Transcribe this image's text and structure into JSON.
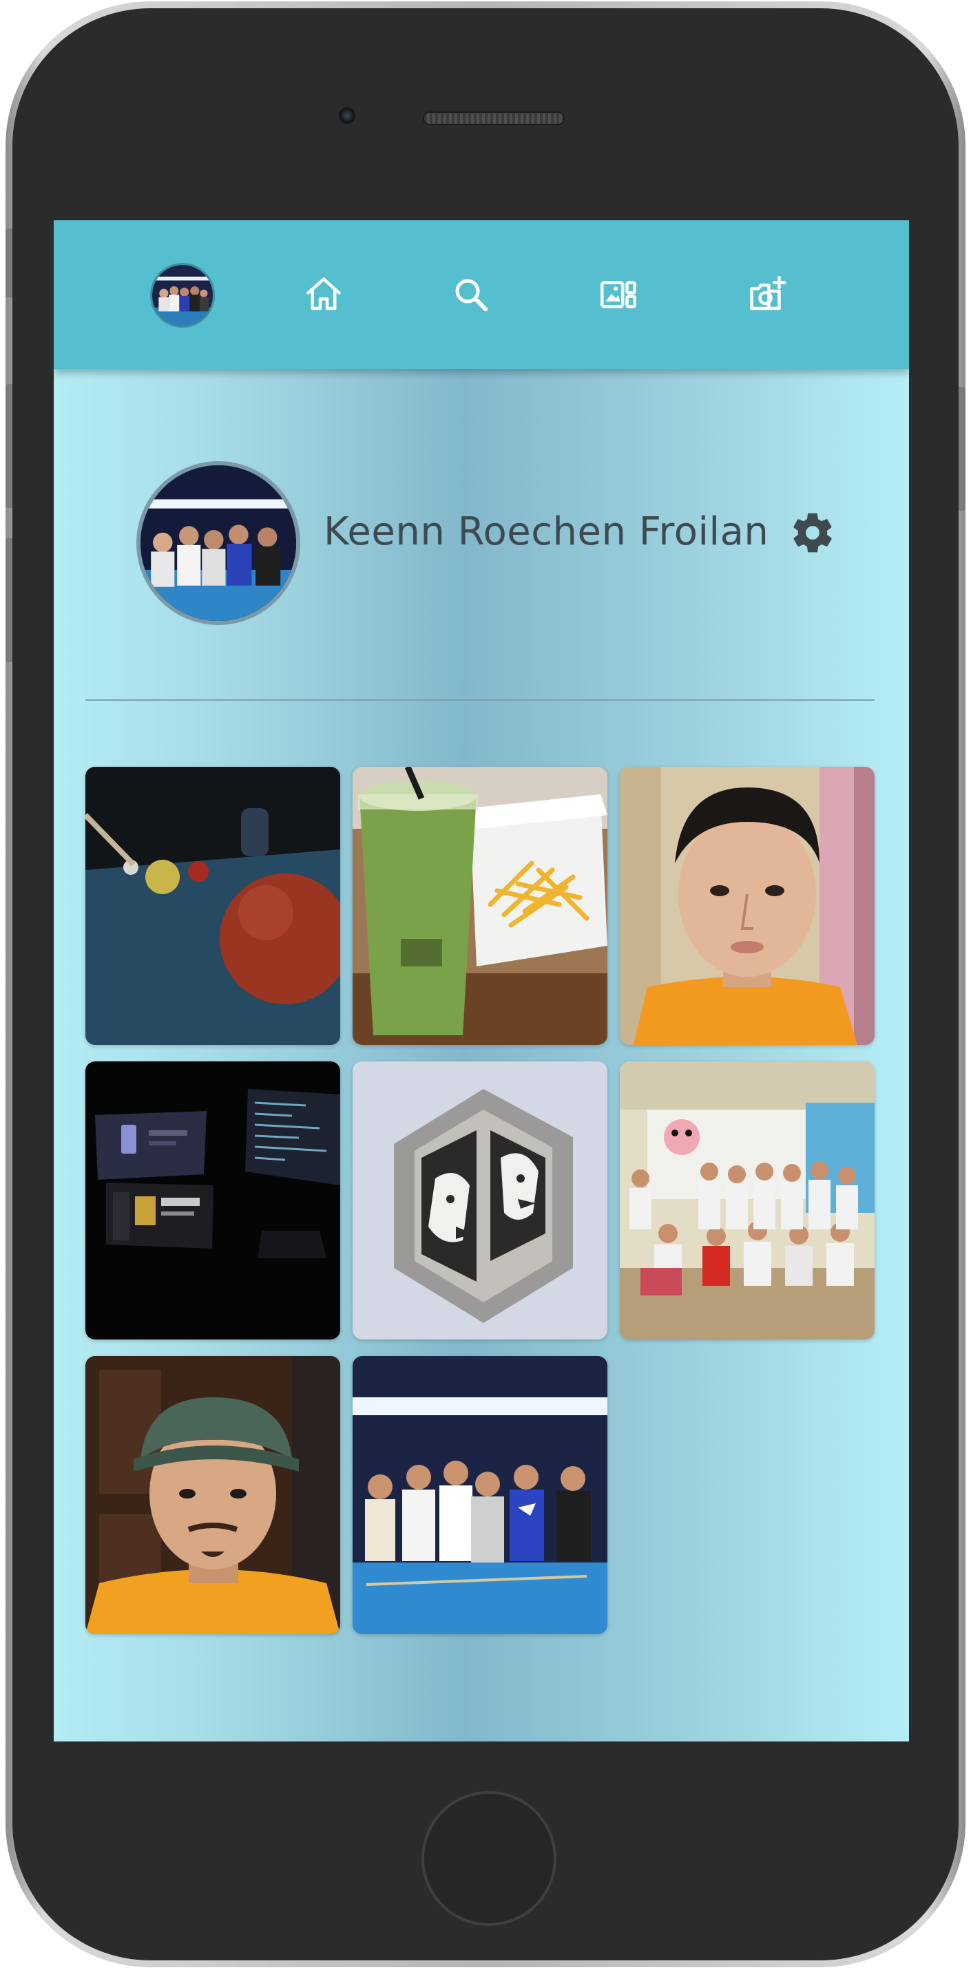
{
  "profile": {
    "name": "Keenn Roechen Froilan"
  },
  "nav": {
    "items": [
      {
        "icon": "home-icon"
      },
      {
        "icon": "search-icon"
      },
      {
        "icon": "gallery-icon"
      },
      {
        "icon": "add-photo-icon"
      }
    ]
  },
  "photos": [
    {
      "subject": "billiards-closeup"
    },
    {
      "subject": "drink-and-fries"
    },
    {
      "subject": "selfie-orange-shirt"
    },
    {
      "subject": "dark-workstation"
    },
    {
      "subject": "wolf-logo-art"
    },
    {
      "subject": "group-photo-classroom"
    },
    {
      "subject": "selfie-cap"
    },
    {
      "subject": "group-photo-billiards"
    }
  ],
  "colors": {
    "navbar": "#55bfcf",
    "screen_light": "#b4ecf4",
    "screen_dark": "#83b8cc",
    "text": "#3e4a50"
  }
}
